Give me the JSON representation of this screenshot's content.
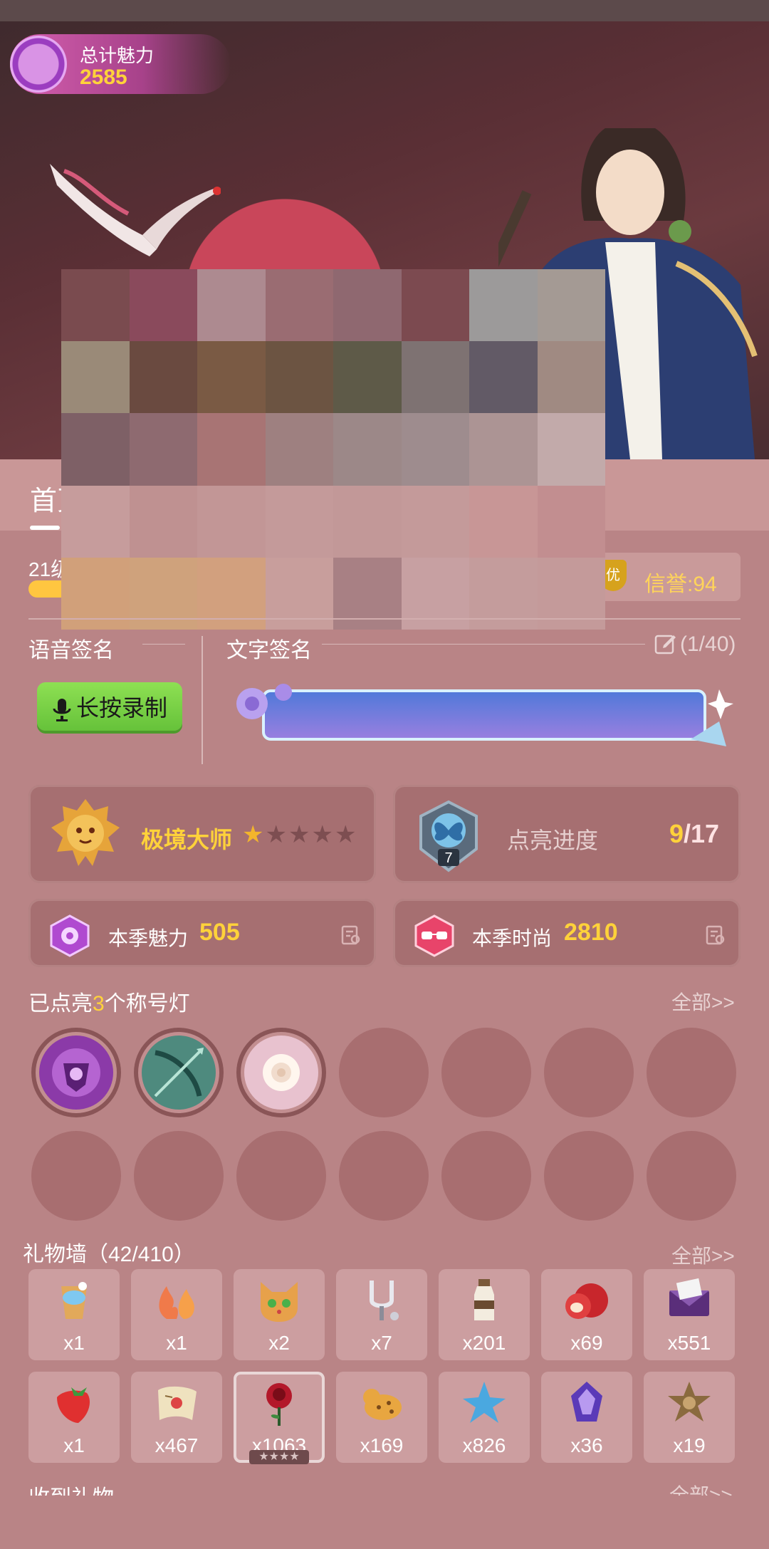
{
  "profile": {
    "total_charm_label": "总计魅力",
    "total_charm_value": "2585"
  },
  "tabs": [
    {
      "label": "首页"
    }
  ],
  "level_text": "21级",
  "credit_badge": "优",
  "credit_text": "信誉:94",
  "signatures": {
    "voice_title": "语音签名",
    "text_title": "文字签名",
    "char_count": "(1/40)",
    "record_label": "长按录制"
  },
  "rank": {
    "name": "极境大师",
    "stars_total": 5,
    "stars_filled": 1
  },
  "progress": {
    "label": "点亮进度",
    "current": "9",
    "total": "/17",
    "badge_level": "7"
  },
  "season": {
    "charm_label": "本季魅力",
    "charm_value": "505",
    "fashion_label": "本季时尚",
    "fashion_value": "2810"
  },
  "titles": {
    "prefix": "已点亮",
    "count": "3",
    "suffix": "个称号灯",
    "all_label": "全部>>"
  },
  "gift_wall": {
    "title": "礼物墙（42/410）",
    "all_label": "全部>>",
    "items": [
      {
        "count": "x1",
        "icon": "glass-drink-icon"
      },
      {
        "count": "x1",
        "icon": "twin-flames-icon"
      },
      {
        "count": "x2",
        "icon": "cat-face-icon"
      },
      {
        "count": "x7",
        "icon": "tuning-fork-icon"
      },
      {
        "count": "x201",
        "icon": "milk-bottle-icon"
      },
      {
        "count": "x69",
        "icon": "apple-icon"
      },
      {
        "count": "x551",
        "icon": "envelope-icon"
      },
      {
        "count": "x1",
        "icon": "strawberry-icon"
      },
      {
        "count": "x467",
        "icon": "scroll-icon"
      },
      {
        "count": "x1063",
        "icon": "rose-icon"
      },
      {
        "count": "x169",
        "icon": "leopard-icon"
      },
      {
        "count": "x826",
        "icon": "starfish-icon"
      },
      {
        "count": "x36",
        "icon": "crystal-icon"
      },
      {
        "count": "x19",
        "icon": "sheriff-star-icon"
      }
    ]
  },
  "received": {
    "title": "收到礼物",
    "all_label": "全部>>"
  },
  "colors": {
    "accent_yellow": "#ffd23a",
    "background": "#b98486",
    "card": "#a66f71",
    "record_button": "#7fd24a"
  }
}
